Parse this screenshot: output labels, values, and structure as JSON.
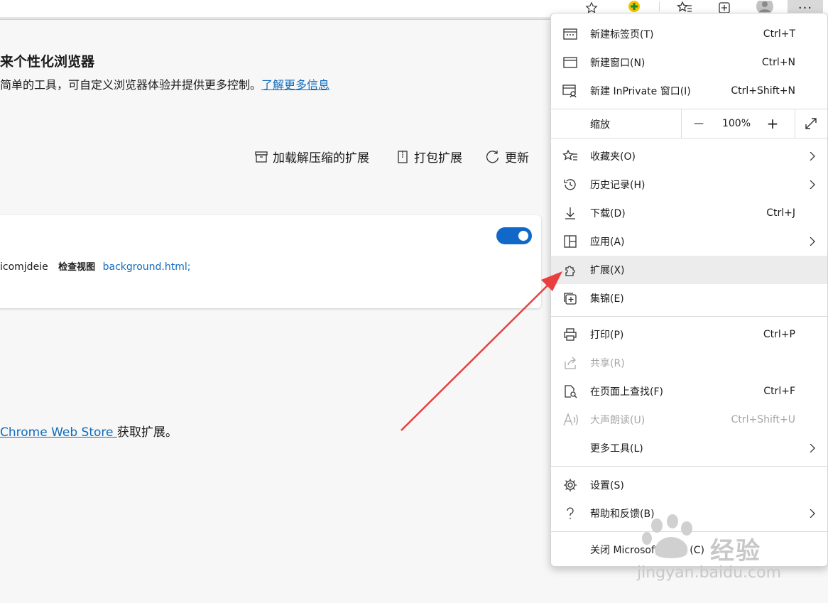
{
  "toolbar": {
    "icons": [
      "favorite-star-icon",
      "extension-badge-icon",
      "favorites-icon",
      "collections-icon",
      "profile-avatar-icon",
      "more-icon"
    ],
    "more_label": "···"
  },
  "page": {
    "title": "来个性化浏览器",
    "description": "简单的工具，可自定义浏览器体验并提供更多控制。",
    "learn_more": "了解更多信息",
    "actions": [
      {
        "label": "加载解压缩的扩展",
        "icon": "archive-icon"
      },
      {
        "label": "打包扩展",
        "icon": "zip-icon"
      },
      {
        "label": "更新",
        "icon": "refresh-icon"
      }
    ],
    "card": {
      "id_fragment": "icomjdeie",
      "inspect_label": "检查视图",
      "inspect_link": "background.html;",
      "enabled": true
    },
    "store": {
      "link": "Chrome Web Store ",
      "suffix": "获取扩展。"
    }
  },
  "menu": {
    "items": [
      {
        "label": "新建标签页(T)",
        "shortcut": "Ctrl+T",
        "icon": "new-tab-icon"
      },
      {
        "label": "新建窗口(N)",
        "shortcut": "Ctrl+N",
        "icon": "new-window-icon"
      },
      {
        "label": "新建 InPrivate 窗口(I)",
        "shortcut": "Ctrl+Shift+N",
        "icon": "inprivate-icon"
      }
    ],
    "zoom": {
      "label": "缩放",
      "minus": "—",
      "value": "100%",
      "plus": "+"
    },
    "items2": [
      {
        "label": "收藏夹(O)",
        "icon": "favorites-icon",
        "submenu": true
      },
      {
        "label": "历史记录(H)",
        "icon": "history-icon",
        "submenu": true
      },
      {
        "label": "下载(D)",
        "shortcut": "Ctrl+J",
        "icon": "download-icon"
      },
      {
        "label": "应用(A)",
        "icon": "apps-icon",
        "submenu": true
      },
      {
        "label": "扩展(X)",
        "icon": "extensions-icon",
        "highlighted": true
      },
      {
        "label": "集锦(E)",
        "icon": "collections-icon"
      }
    ],
    "items3": [
      {
        "label": "打印(P)",
        "shortcut": "Ctrl+P",
        "icon": "print-icon"
      },
      {
        "label": "共享(R)",
        "icon": "share-icon",
        "disabled": true
      },
      {
        "label": "在页面上查找(F)",
        "shortcut": "Ctrl+F",
        "icon": "find-icon"
      },
      {
        "label": "大声朗读(U)",
        "shortcut": "Ctrl+Shift+U",
        "icon": "read-aloud-icon",
        "disabled": true
      },
      {
        "label": "更多工具(L)",
        "submenu": true
      }
    ],
    "items4": [
      {
        "label": "设置(S)",
        "icon": "settings-icon"
      },
      {
        "label": "帮助和反馈(B)",
        "icon": "help-icon",
        "submenu": true
      }
    ],
    "close_label": "关闭 Microsoft Edge (C)"
  },
  "watermark": {
    "brand": "经验",
    "domain": "jingyan.baidu.com"
  },
  "colors": {
    "accent": "#0f6cbd",
    "toggle": "#1068c8",
    "arrow": "#e8403f",
    "highlight": "#ececec"
  }
}
